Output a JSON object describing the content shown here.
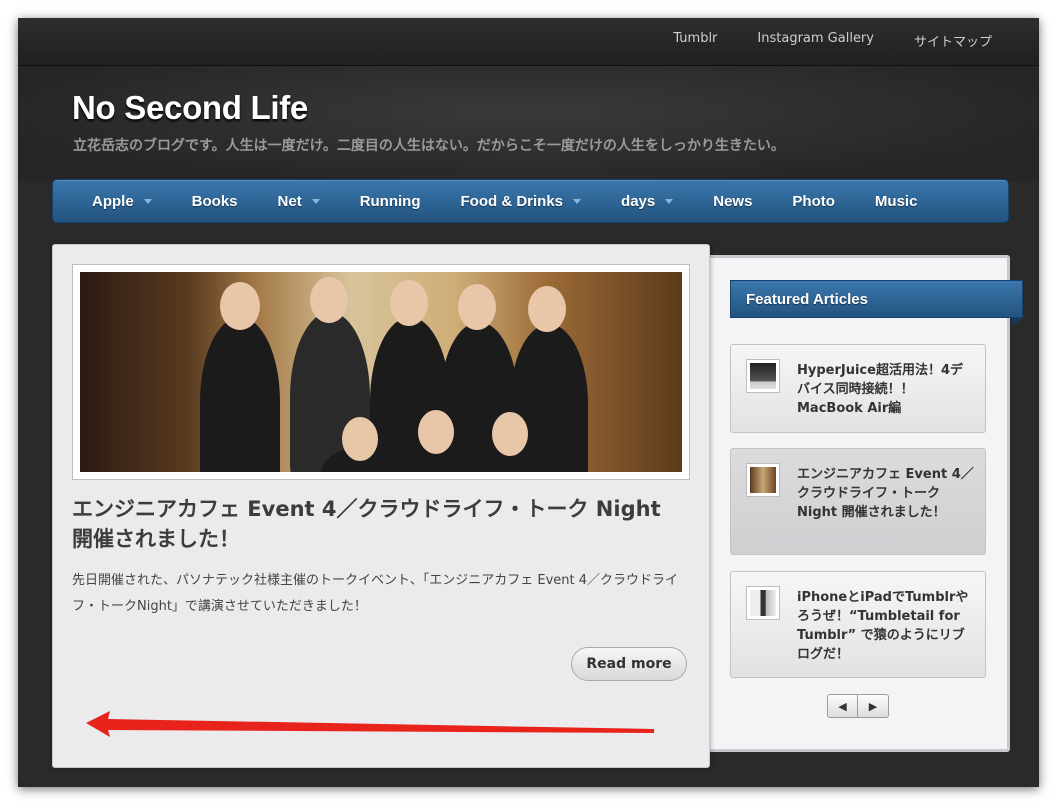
{
  "topbar": {
    "links": [
      "Tumblr",
      "Instagram Gallery",
      "サイトマップ"
    ]
  },
  "header": {
    "title": "No Second Life",
    "tagline": "立花岳志のブログです。人生は一度だけ。二度目の人生はない。だからこそ一度だけの人生をしっかり生きたい。"
  },
  "nav": {
    "items": [
      {
        "label": "Apple",
        "dropdown": true
      },
      {
        "label": "Books",
        "dropdown": false
      },
      {
        "label": "Net",
        "dropdown": true
      },
      {
        "label": "Running",
        "dropdown": false
      },
      {
        "label": "Food & Drinks",
        "dropdown": true
      },
      {
        "label": "days",
        "dropdown": true
      },
      {
        "label": "News",
        "dropdown": false
      },
      {
        "label": "Photo",
        "dropdown": false
      },
      {
        "label": "Music",
        "dropdown": false
      }
    ]
  },
  "post": {
    "title": "エンジニアカフェ Event 4／クラウドライフ・トーク Night 開催されました！",
    "excerpt": "先日開催された、パソナテック社様主催のトークイベント、「エンジニアカフェ Event 4／クラウドライフ・トークNight」で講演させていただきました！",
    "read_more": "Read more"
  },
  "featured": {
    "heading": "Featured Articles",
    "items": [
      {
        "title": "HyperJuice超活用法！4デバイス同時接続！！MacBook Air編",
        "thumb_icon": "laptop-thumb-icon"
      },
      {
        "title": "エンジニアカフェ Event 4／クラウドライフ・トークNight 開催されました！",
        "thumb_icon": "group-photo-thumb-icon"
      },
      {
        "title": "iPhoneとiPadでTumblrやろうぜ！“Tumbletail for Tumblr” で猿のようにリブログだ！",
        "thumb_icon": "tumblr-thumb-icon"
      }
    ],
    "pager": {
      "prev": "◀",
      "next": "▶"
    }
  },
  "colors": {
    "nav_blue": "#2d6698",
    "annotation_arrow": "#e8231b",
    "page_dark": "#2a2a2a"
  }
}
